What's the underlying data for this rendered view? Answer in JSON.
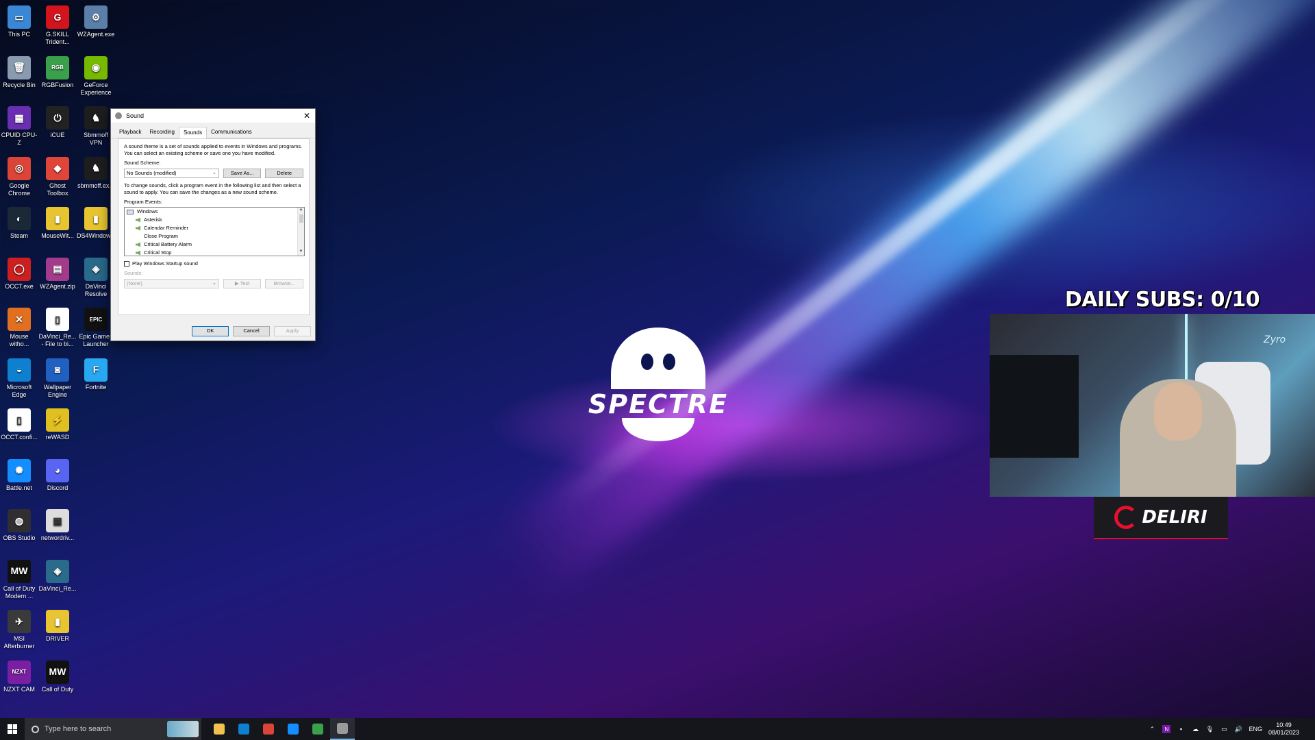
{
  "desktop": {
    "icons": [
      {
        "label": "This PC",
        "color": "#3a87d6",
        "glyph": "▭"
      },
      {
        "label": "G.SKILL Trident...",
        "color": "#d4141c",
        "glyph": "G"
      },
      {
        "label": "WZAgent.exe",
        "color": "#5a7fa8",
        "glyph": "⚙"
      },
      {
        "label": "Recycle Bin",
        "color": "#8a9bb0",
        "glyph": "🗑"
      },
      {
        "label": "RGBFusion",
        "color": "#3aa04a",
        "glyph": "RGB"
      },
      {
        "label": "GeForce Experience",
        "color": "#76b900",
        "glyph": "◉"
      },
      {
        "label": "CPUID CPU-Z",
        "color": "#6a2fb0",
        "glyph": "▦"
      },
      {
        "label": "iCUE",
        "color": "#222222",
        "glyph": "⏻"
      },
      {
        "label": "Sbmmoff VPN",
        "color": "#1d1d1d",
        "glyph": "♞"
      },
      {
        "label": "Google Chrome",
        "color": "#db4437",
        "glyph": "◎"
      },
      {
        "label": "Ghost Toolbox",
        "color": "#e0453a",
        "glyph": "◆"
      },
      {
        "label": "sbmmoff.ex...",
        "color": "#1d1d1d",
        "glyph": "♞"
      },
      {
        "label": "Steam",
        "color": "#1b2838",
        "glyph": "◐"
      },
      {
        "label": "MouseWit...",
        "color": "#e8c530",
        "glyph": "▮"
      },
      {
        "label": "DS4Window...",
        "color": "#e8c530",
        "glyph": "▮"
      },
      {
        "label": "OCCT.exe",
        "color": "#cc1f1f",
        "glyph": "◯"
      },
      {
        "label": "WZAgent.zip",
        "color": "#a33a8a",
        "glyph": "▤"
      },
      {
        "label": "DaVinci Resolve",
        "color": "#2a6a8a",
        "glyph": "◈"
      },
      {
        "label": "Mouse witho...",
        "color": "#e07020",
        "glyph": "✕"
      },
      {
        "label": "DaVinci_Re... - File to bi...",
        "color": "#ffffff",
        "glyph": "▯"
      },
      {
        "label": "Epic Games Launcher",
        "color": "#111111",
        "glyph": "EPIC"
      },
      {
        "label": "Microsoft Edge",
        "color": "#0f7fcf",
        "glyph": "◒"
      },
      {
        "label": "Wallpaper Engine",
        "color": "#2060c0",
        "glyph": "◙"
      },
      {
        "label": "Fortnite",
        "color": "#27a8f0",
        "glyph": "F"
      },
      {
        "label": "OCCT.confi...",
        "color": "#ffffff",
        "glyph": "▯"
      },
      {
        "label": "reWASD",
        "color": "#e0c020",
        "glyph": "⚡"
      },
      {
        "label": "",
        "color": "",
        "glyph": ""
      },
      {
        "label": "Battle.net",
        "color": "#148eff",
        "glyph": "✺"
      },
      {
        "label": "Discord",
        "color": "#5865f2",
        "glyph": "◕"
      },
      {
        "label": "",
        "color": "",
        "glyph": ""
      },
      {
        "label": "OBS Studio",
        "color": "#302e31",
        "glyph": "◍"
      },
      {
        "label": "networdriv...",
        "color": "#dddddd",
        "glyph": "▣"
      },
      {
        "label": "",
        "color": "",
        "glyph": ""
      },
      {
        "label": "Call of Duty Modern ...",
        "color": "#111111",
        "glyph": "MW"
      },
      {
        "label": "DaVinci_Re...",
        "color": "#2a6a8a",
        "glyph": "◈"
      },
      {
        "label": "",
        "color": "",
        "glyph": ""
      },
      {
        "label": "MSI Afterburner",
        "color": "#3a3a3a",
        "glyph": "✈"
      },
      {
        "label": "DRIVER",
        "color": "#e8c530",
        "glyph": "▮"
      },
      {
        "label": "",
        "color": "",
        "glyph": ""
      },
      {
        "label": "NZXT CAM",
        "color": "#7b1fa2",
        "glyph": "NZXT"
      },
      {
        "label": "Call of Duty",
        "color": "#111111",
        "glyph": "MW"
      }
    ]
  },
  "sound_dialog": {
    "title": "Sound",
    "tabs": [
      "Playback",
      "Recording",
      "Sounds",
      "Communications"
    ],
    "active_tab": "Sounds",
    "intro": "A sound theme is a set of sounds applied to events in Windows and programs. You can select an existing scheme or save one you have modified.",
    "scheme_label": "Sound Scheme:",
    "scheme_value": "No Sounds (modified)",
    "save_as": "Save As...",
    "delete": "Delete",
    "instructions": "To change sounds, click a program event in the following list and then select a sound to apply. You can save the changes as a new sound scheme.",
    "events_label": "Program Events:",
    "events": [
      "Windows",
      "Asterisk",
      "Calendar Reminder",
      "Close Program",
      "Critical Battery Alarm",
      "Critical Stop"
    ],
    "startup_checkbox": "Play Windows Startup sound",
    "sounds_label": "Sounds:",
    "sounds_value": "(None)",
    "test": "Test",
    "browse": "Browse...",
    "ok": "OK",
    "cancel": "Cancel",
    "apply": "Apply"
  },
  "wallpaper": {
    "brand": "SPECTRE"
  },
  "overlay": {
    "subs_goal": "DAILY SUBS: 0/10",
    "webcam_tag": "Zyro",
    "streamer_name": "DELIRI"
  },
  "taskbar": {
    "search_placeholder": "Type here to search",
    "apps": [
      {
        "name": "file-explorer",
        "color": "#f2c14e"
      },
      {
        "name": "edge",
        "color": "#0f7fcf"
      },
      {
        "name": "chrome",
        "color": "#db4437"
      },
      {
        "name": "battle-net",
        "color": "#148eff"
      },
      {
        "name": "nvidia-app",
        "color": "#3aa04a"
      },
      {
        "name": "sound",
        "color": "#9a9a9a"
      }
    ],
    "language": "ENG",
    "time": "10:49",
    "date": "08/01/2023"
  }
}
